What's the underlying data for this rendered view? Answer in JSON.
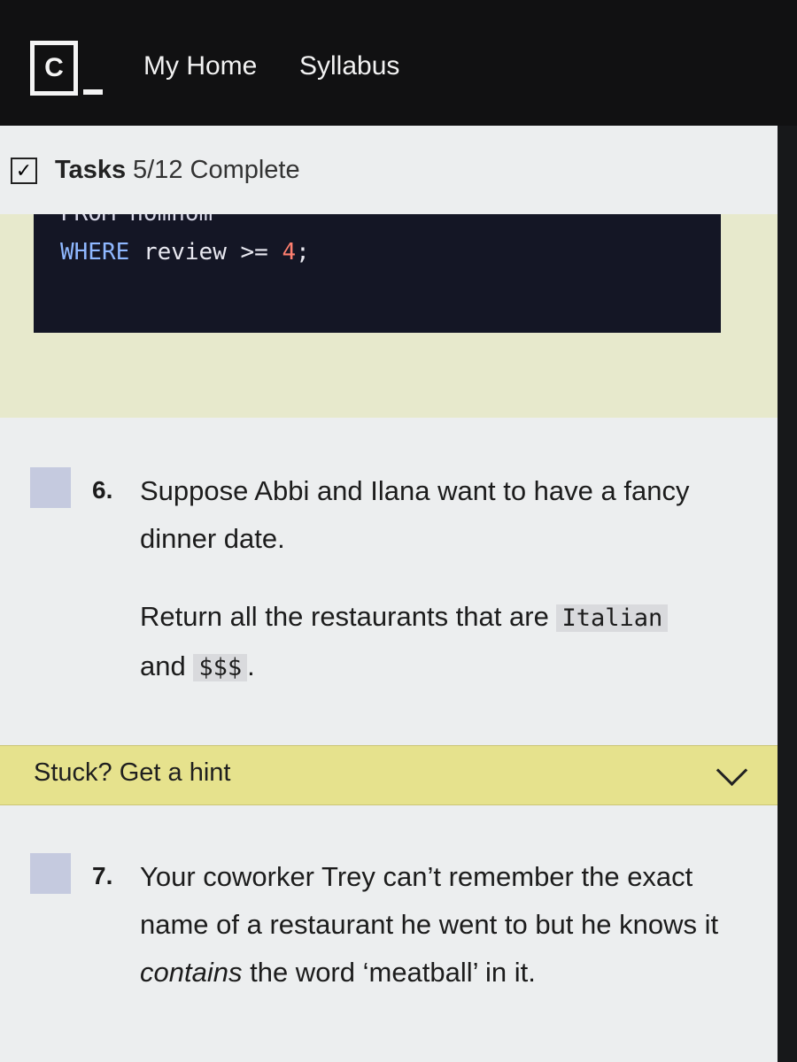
{
  "nav": {
    "logo_letter": "C",
    "links": [
      "My Home",
      "Syllabus"
    ]
  },
  "tasks_bar": {
    "label": "Tasks",
    "status": "5/12 Complete"
  },
  "code": {
    "prev_line_partial": "FROM nomnom",
    "keyword": "WHERE",
    "identifier": "review",
    "operator": ">=",
    "number": "4",
    "terminator": ";"
  },
  "task6": {
    "number": "6.",
    "line1": "Suppose Abbi and Ilana want to have a fancy dinner date.",
    "line2_prefix": "Return all the restaurants that are",
    "code1": "Italian",
    "and": "and",
    "code2": "$$$",
    "period": "."
  },
  "hint": {
    "label": "Stuck? Get a hint"
  },
  "task7": {
    "number": "7.",
    "text_part1": "Your coworker Trey can’t remember the exact name of a restaurant he went to but he knows it",
    "emphasis": "contains",
    "text_part2": "the word ‘meatball’ in it."
  }
}
